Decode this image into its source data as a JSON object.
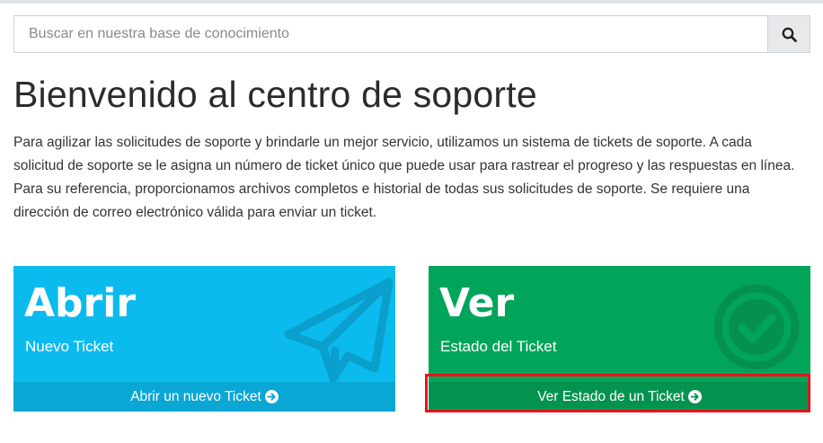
{
  "search": {
    "placeholder": "Buscar en nuestra base de conocimiento",
    "icon": "search-icon"
  },
  "page_title": "Bienvenido al centro de soporte",
  "intro": "Para agilizar las solicitudes de soporte y brindarle un mejor servicio, utilizamos un sistema de tickets de soporte. A cada solicitud de soporte se le asigna un número de ticket único que puede usar para rastrear el progreso y las respuestas en línea. Para su referencia, proporcionamos archivos completos e historial de todas sus solicitudes de soporte. Se requiere una dirección de correo electrónico válida para enviar un ticket.",
  "cards": {
    "open": {
      "title": "Abrir",
      "subtitle": "Nuevo Ticket",
      "action": "Abrir un nuevo Ticket",
      "icon": "paper-plane-icon",
      "color": "#0bbbed",
      "footer_color": "#0aa6d4"
    },
    "view": {
      "title": "Ver",
      "subtitle": "Estado del Ticket",
      "action": "Ver Estado de un Ticket",
      "icon": "check-circle-icon",
      "color": "#00a55a",
      "footer_color": "#04934f"
    }
  },
  "colors": {
    "highlight": "#e3151a"
  }
}
